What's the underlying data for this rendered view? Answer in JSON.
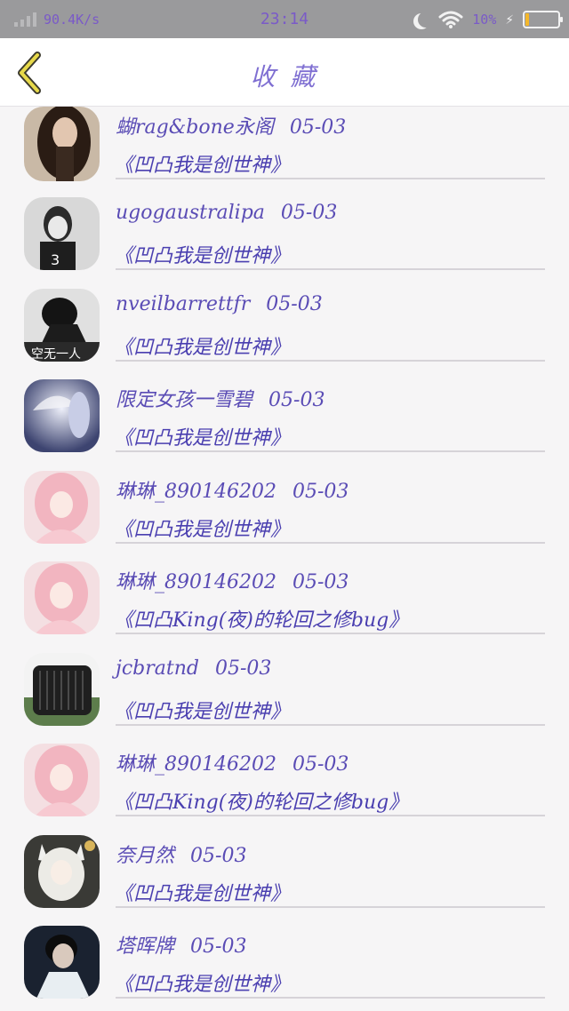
{
  "status_bar": {
    "speed": "90.4K/s",
    "time": "23:14",
    "battery_percent": "10%",
    "battery_level": 0.1
  },
  "header": {
    "title": "收 藏",
    "back_icon": "chevron-left-icon"
  },
  "items": [
    {
      "user": "蝴rag&bone永阁",
      "date": "05-03",
      "book": "《凹凸我是创世神》",
      "avatar": "avatar-girl-dark-hair"
    },
    {
      "user": "ugogaustralipa",
      "date": "05-03",
      "book": "《凹凸我是创世神》",
      "avatar": "avatar-boy-grayscale"
    },
    {
      "user": "nveilbarrettfr",
      "date": "05-03",
      "book": "《凹凸我是创世神》",
      "avatar": "avatar-boy-kneeling",
      "avatar_text": "空无一人"
    },
    {
      "user": "限定女孩一雪碧",
      "date": "05-03",
      "book": "《凹凸我是创世神》",
      "avatar": "avatar-anime-umbrella"
    },
    {
      "user": "琳琳_890146202",
      "date": "05-03",
      "book": "《凹凸我是创世神》",
      "avatar": "avatar-anime-pink-hair"
    },
    {
      "user": "琳琳_890146202",
      "date": "05-03",
      "book": "《凹凸King(夜)的轮回之修bug》",
      "avatar": "avatar-anime-pink-hair"
    },
    {
      "user": "jcbratnd",
      "date": "05-03",
      "book": "《凹凸我是创世神》",
      "avatar": "avatar-dark-object"
    },
    {
      "user": "琳琳_890146202",
      "date": "05-03",
      "book": "《凹凸King(夜)的轮回之修bug》",
      "avatar": "avatar-anime-pink-hair"
    },
    {
      "user": "奈月然",
      "date": "05-03",
      "book": "《凹凸我是创世神》",
      "avatar": "avatar-anime-fox-girl"
    },
    {
      "user": "塔晖牌",
      "date": "05-03",
      "book": "《凹凸我是创世神》",
      "avatar": "avatar-boy-dark"
    }
  ]
}
